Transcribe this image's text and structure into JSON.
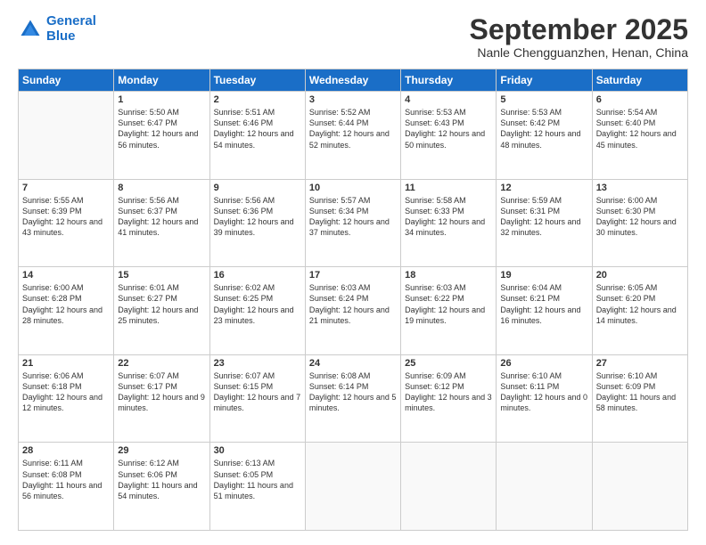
{
  "logo": {
    "line1": "General",
    "line2": "Blue"
  },
  "title": "September 2025",
  "location": "Nanle Chengguanzhen, Henan, China",
  "days_header": [
    "Sunday",
    "Monday",
    "Tuesday",
    "Wednesday",
    "Thursday",
    "Friday",
    "Saturday"
  ],
  "weeks": [
    [
      {
        "day": "",
        "sunrise": "",
        "sunset": "",
        "daylight": ""
      },
      {
        "day": "1",
        "sunrise": "Sunrise: 5:50 AM",
        "sunset": "Sunset: 6:47 PM",
        "daylight": "Daylight: 12 hours and 56 minutes."
      },
      {
        "day": "2",
        "sunrise": "Sunrise: 5:51 AM",
        "sunset": "Sunset: 6:46 PM",
        "daylight": "Daylight: 12 hours and 54 minutes."
      },
      {
        "day": "3",
        "sunrise": "Sunrise: 5:52 AM",
        "sunset": "Sunset: 6:44 PM",
        "daylight": "Daylight: 12 hours and 52 minutes."
      },
      {
        "day": "4",
        "sunrise": "Sunrise: 5:53 AM",
        "sunset": "Sunset: 6:43 PM",
        "daylight": "Daylight: 12 hours and 50 minutes."
      },
      {
        "day": "5",
        "sunrise": "Sunrise: 5:53 AM",
        "sunset": "Sunset: 6:42 PM",
        "daylight": "Daylight: 12 hours and 48 minutes."
      },
      {
        "day": "6",
        "sunrise": "Sunrise: 5:54 AM",
        "sunset": "Sunset: 6:40 PM",
        "daylight": "Daylight: 12 hours and 45 minutes."
      }
    ],
    [
      {
        "day": "7",
        "sunrise": "Sunrise: 5:55 AM",
        "sunset": "Sunset: 6:39 PM",
        "daylight": "Daylight: 12 hours and 43 minutes."
      },
      {
        "day": "8",
        "sunrise": "Sunrise: 5:56 AM",
        "sunset": "Sunset: 6:37 PM",
        "daylight": "Daylight: 12 hours and 41 minutes."
      },
      {
        "day": "9",
        "sunrise": "Sunrise: 5:56 AM",
        "sunset": "Sunset: 6:36 PM",
        "daylight": "Daylight: 12 hours and 39 minutes."
      },
      {
        "day": "10",
        "sunrise": "Sunrise: 5:57 AM",
        "sunset": "Sunset: 6:34 PM",
        "daylight": "Daylight: 12 hours and 37 minutes."
      },
      {
        "day": "11",
        "sunrise": "Sunrise: 5:58 AM",
        "sunset": "Sunset: 6:33 PM",
        "daylight": "Daylight: 12 hours and 34 minutes."
      },
      {
        "day": "12",
        "sunrise": "Sunrise: 5:59 AM",
        "sunset": "Sunset: 6:31 PM",
        "daylight": "Daylight: 12 hours and 32 minutes."
      },
      {
        "day": "13",
        "sunrise": "Sunrise: 6:00 AM",
        "sunset": "Sunset: 6:30 PM",
        "daylight": "Daylight: 12 hours and 30 minutes."
      }
    ],
    [
      {
        "day": "14",
        "sunrise": "Sunrise: 6:00 AM",
        "sunset": "Sunset: 6:28 PM",
        "daylight": "Daylight: 12 hours and 28 minutes."
      },
      {
        "day": "15",
        "sunrise": "Sunrise: 6:01 AM",
        "sunset": "Sunset: 6:27 PM",
        "daylight": "Daylight: 12 hours and 25 minutes."
      },
      {
        "day": "16",
        "sunrise": "Sunrise: 6:02 AM",
        "sunset": "Sunset: 6:25 PM",
        "daylight": "Daylight: 12 hours and 23 minutes."
      },
      {
        "day": "17",
        "sunrise": "Sunrise: 6:03 AM",
        "sunset": "Sunset: 6:24 PM",
        "daylight": "Daylight: 12 hours and 21 minutes."
      },
      {
        "day": "18",
        "sunrise": "Sunrise: 6:03 AM",
        "sunset": "Sunset: 6:22 PM",
        "daylight": "Daylight: 12 hours and 19 minutes."
      },
      {
        "day": "19",
        "sunrise": "Sunrise: 6:04 AM",
        "sunset": "Sunset: 6:21 PM",
        "daylight": "Daylight: 12 hours and 16 minutes."
      },
      {
        "day": "20",
        "sunrise": "Sunrise: 6:05 AM",
        "sunset": "Sunset: 6:20 PM",
        "daylight": "Daylight: 12 hours and 14 minutes."
      }
    ],
    [
      {
        "day": "21",
        "sunrise": "Sunrise: 6:06 AM",
        "sunset": "Sunset: 6:18 PM",
        "daylight": "Daylight: 12 hours and 12 minutes."
      },
      {
        "day": "22",
        "sunrise": "Sunrise: 6:07 AM",
        "sunset": "Sunset: 6:17 PM",
        "daylight": "Daylight: 12 hours and 9 minutes."
      },
      {
        "day": "23",
        "sunrise": "Sunrise: 6:07 AM",
        "sunset": "Sunset: 6:15 PM",
        "daylight": "Daylight: 12 hours and 7 minutes."
      },
      {
        "day": "24",
        "sunrise": "Sunrise: 6:08 AM",
        "sunset": "Sunset: 6:14 PM",
        "daylight": "Daylight: 12 hours and 5 minutes."
      },
      {
        "day": "25",
        "sunrise": "Sunrise: 6:09 AM",
        "sunset": "Sunset: 6:12 PM",
        "daylight": "Daylight: 12 hours and 3 minutes."
      },
      {
        "day": "26",
        "sunrise": "Sunrise: 6:10 AM",
        "sunset": "Sunset: 6:11 PM",
        "daylight": "Daylight: 12 hours and 0 minutes."
      },
      {
        "day": "27",
        "sunrise": "Sunrise: 6:10 AM",
        "sunset": "Sunset: 6:09 PM",
        "daylight": "Daylight: 11 hours and 58 minutes."
      }
    ],
    [
      {
        "day": "28",
        "sunrise": "Sunrise: 6:11 AM",
        "sunset": "Sunset: 6:08 PM",
        "daylight": "Daylight: 11 hours and 56 minutes."
      },
      {
        "day": "29",
        "sunrise": "Sunrise: 6:12 AM",
        "sunset": "Sunset: 6:06 PM",
        "daylight": "Daylight: 11 hours and 54 minutes."
      },
      {
        "day": "30",
        "sunrise": "Sunrise: 6:13 AM",
        "sunset": "Sunset: 6:05 PM",
        "daylight": "Daylight: 11 hours and 51 minutes."
      },
      {
        "day": "",
        "sunrise": "",
        "sunset": "",
        "daylight": ""
      },
      {
        "day": "",
        "sunrise": "",
        "sunset": "",
        "daylight": ""
      },
      {
        "day": "",
        "sunrise": "",
        "sunset": "",
        "daylight": ""
      },
      {
        "day": "",
        "sunrise": "",
        "sunset": "",
        "daylight": ""
      }
    ]
  ]
}
